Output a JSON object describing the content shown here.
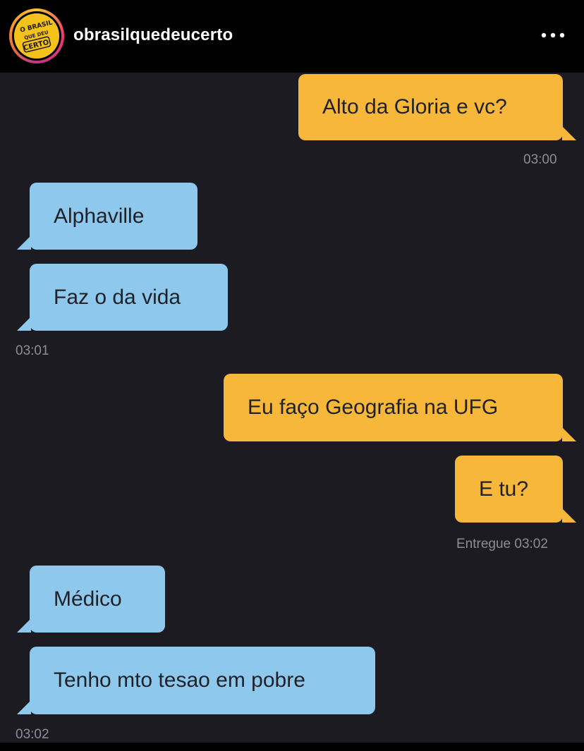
{
  "header": {
    "username": "obrasilquedeucerto",
    "avatar_text": [
      "O BRASIL",
      "QUE DEU",
      "CERTO"
    ],
    "more_icon": "more-horizontal-icon"
  },
  "colors": {
    "outgoing_bubble": "#f7b73a",
    "incoming_bubble": "#8ec8ec",
    "chat_background": "#1c1b21",
    "timestamp": "#8d8e95"
  },
  "messages": [
    {
      "direction": "out",
      "text": "Alto da Gloria e vc?"
    },
    {
      "timestamp": "03:00"
    },
    {
      "direction": "in",
      "text": "Alphaville"
    },
    {
      "direction": "in",
      "text": "Faz o da vida"
    },
    {
      "timestamp": "03:01"
    },
    {
      "direction": "out",
      "text": "Eu faço Geografia na UFG"
    },
    {
      "direction": "out",
      "text": "E tu?"
    },
    {
      "timestamp": "Entregue 03:02"
    },
    {
      "direction": "in",
      "text": "Médico"
    },
    {
      "direction": "in",
      "text": "Tenho mto tesao em pobre"
    },
    {
      "timestamp": "03:02"
    }
  ]
}
